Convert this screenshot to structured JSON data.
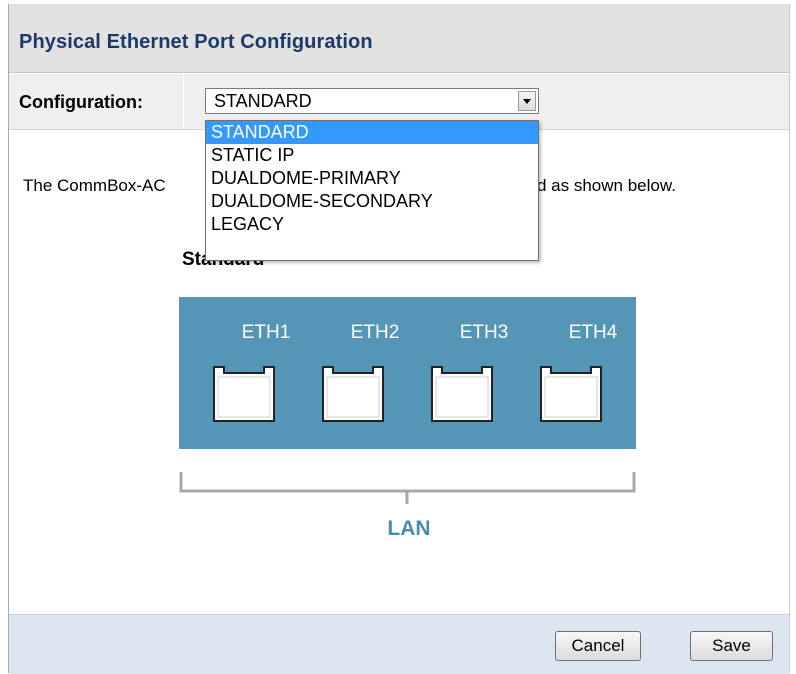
{
  "title": "Physical Ethernet Port Configuration",
  "configuration": {
    "label": "Configuration:",
    "selected": "STANDARD",
    "options": [
      "STANDARD",
      "STATIC IP",
      "DUALDOME-PRIMARY",
      "DUALDOME-SECONDARY",
      "LEGACY"
    ]
  },
  "description": {
    "visible_left": "The CommBox-AC",
    "visible_right": "d as shown below."
  },
  "diagram": {
    "title": "Standard",
    "ports": [
      "ETH1",
      "ETH2",
      "ETH3",
      "ETH4"
    ],
    "group_label": "LAN",
    "colors": {
      "panel": "#5595b6",
      "label": "#4a8bb4",
      "bracket": "#a8a8a8"
    }
  },
  "buttons": {
    "cancel": "Cancel",
    "save": "Save"
  }
}
